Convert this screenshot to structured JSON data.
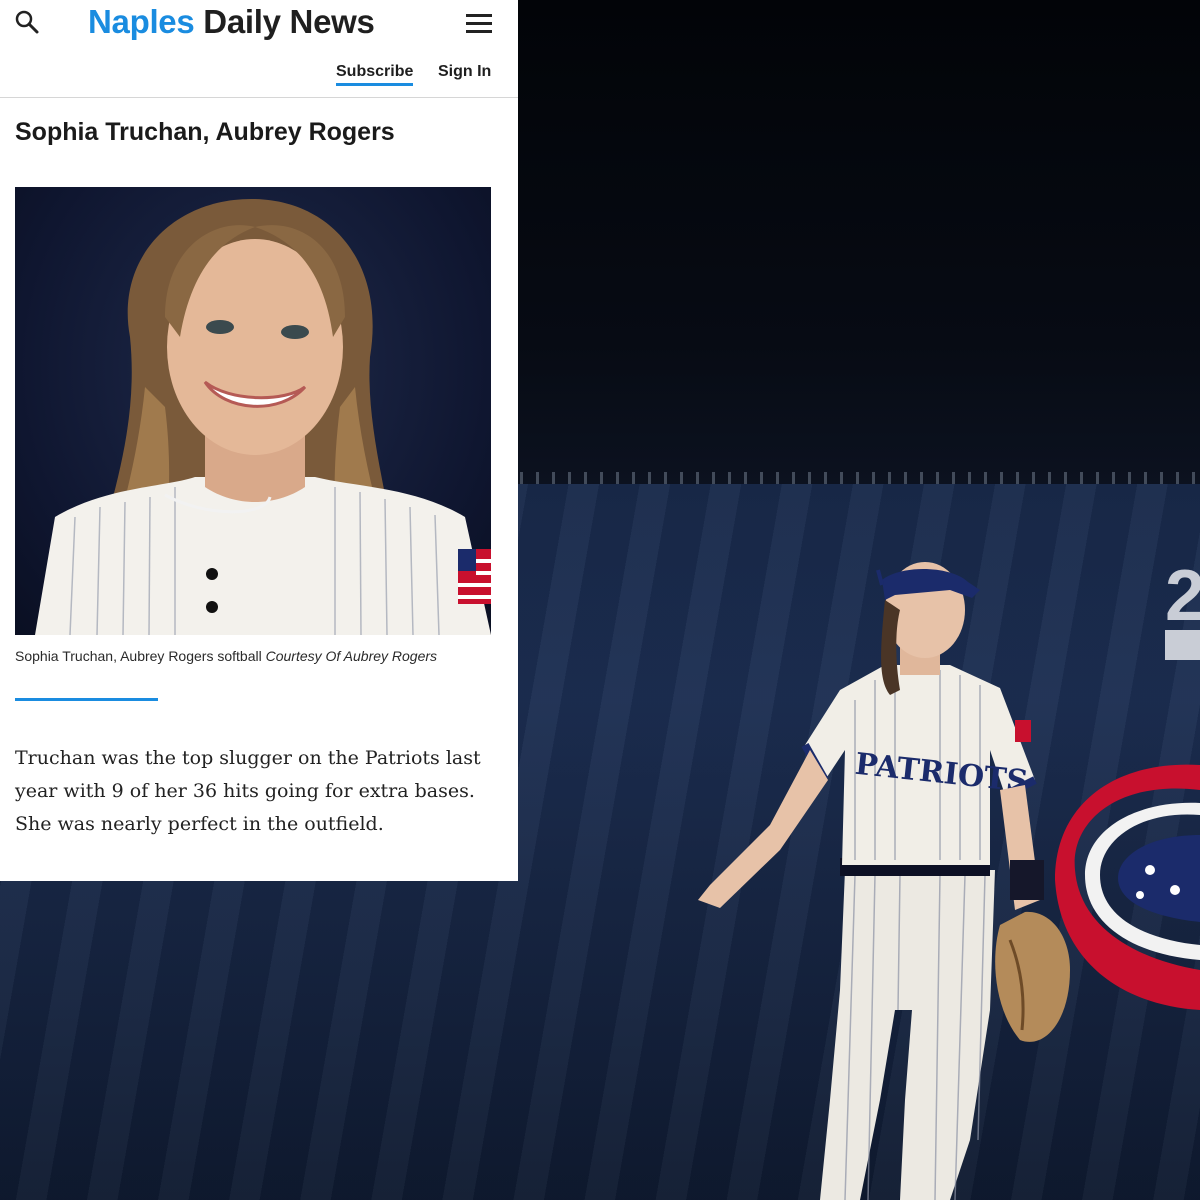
{
  "site": {
    "name_part1": "Naples",
    "name_part2": "Daily News",
    "subscribe_label": "Subscribe",
    "signin_label": "Sign In",
    "brand_color": "#1a8ce0"
  },
  "icons": {
    "search": "search-icon",
    "menu": "hamburger-menu-icon"
  },
  "article": {
    "headline": "Sophia Truchan, Aubrey Rogers",
    "caption_text": "Sophia Truchan, Aubrey Rogers softball",
    "caption_credit": "Courtesy Of Aubrey Rogers",
    "body": "Truchan was the top slugger on the Patriots last year with 9 of her 36 hits going for extra bases. She was nearly perfect in the outfield."
  },
  "background_photo": {
    "jersey_text": "PATRIOTS",
    "wall_text": "2"
  }
}
